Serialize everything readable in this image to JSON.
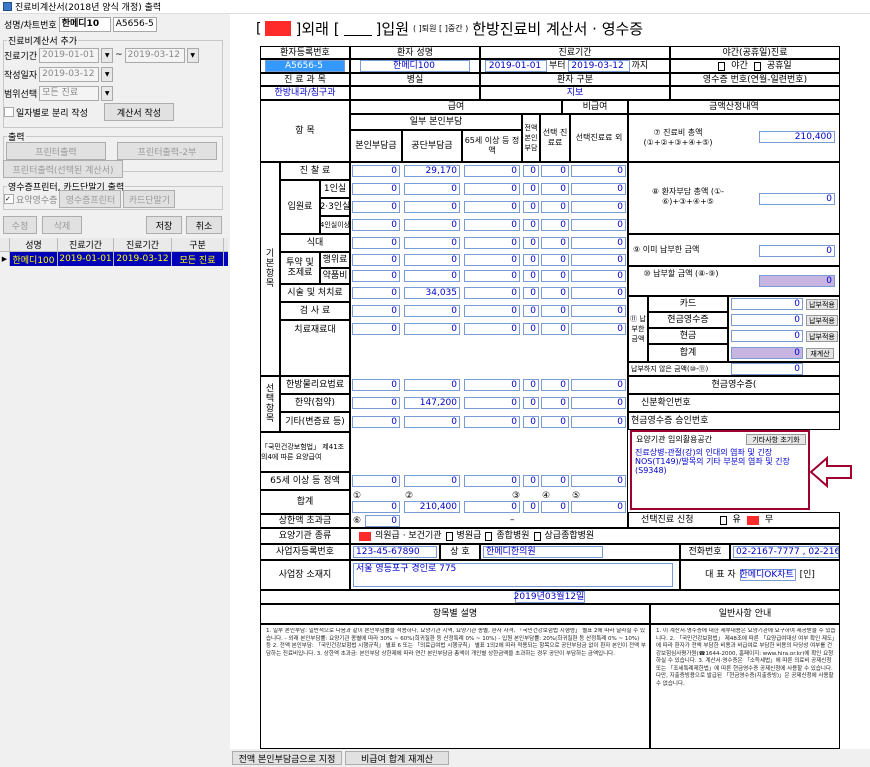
{
  "window": {
    "title": "진료비계산서(2018년 양식 개정) 출력"
  },
  "left": {
    "patient_label": "성명/차트번호",
    "patient_name": "한메디10",
    "chart_no": "A5656-5",
    "group_add_title": "진료비계산서 추가",
    "period_label": "진료기간",
    "period_from": "2019-01-01",
    "period_sep": "~",
    "period_to": "2019-03-12",
    "written_label": "작성일자",
    "written_date": "2019-03-12",
    "range_label": "범위선택",
    "range_value": "모든 진료",
    "split_check_label": "일자별로 분리 작성",
    "make_button": "계산서 작성",
    "group_print_title": "출력",
    "print_button": "프린터출력",
    "print2_button": "프린터출력-2부",
    "print_selected_button": "프린터출력(선택된 계산서)",
    "group_receipt_title": "영수증프린터, 카드단말기 출력",
    "receipt_check_label": "요약영수증",
    "receipt_printer_button": "영수증프린터",
    "card_button": "카드단말기",
    "edit_button": "수정",
    "delete_button": "삭제",
    "save_button": "저장",
    "cancel_button": "취소",
    "grid_headers": [
      "성명",
      "진료기간",
      "진료기간",
      "구분"
    ],
    "grid_rows": [
      {
        "name": "한메디100",
        "from": "2019-01-01",
        "to": "2019-03-12",
        "type": "모든 진료"
      }
    ]
  },
  "doc": {
    "title_outpatient": "]외래 [",
    "title_inpatient": "]입원",
    "title_small": "( ]퇴원 [ ]중간 )",
    "title_main": "한방진료비 계산서 · 영수증",
    "h_reg_no": "환자등록번호",
    "h_patient": "환자 성명",
    "h_period": "진료기간",
    "h_night": "야간(공휴일)진료",
    "reg_no": "A5656-5",
    "patient": "한메디100",
    "period_from": "2019-01-01",
    "period_from_suffix": "부터",
    "period_to": "2019-03-12",
    "period_to_suffix": "까지",
    "night": "야간",
    "holiday": "공휴일",
    "h_dept": "진 료 과 목",
    "h_ward": "병실",
    "h_ptype": "환자 구분",
    "h_receipt_no": "영수증 번호(연월-일련번호)",
    "dept": "한방내과/침구과",
    "ptype": "지보",
    "h_item": "항 목",
    "h_payment": "급여",
    "h_nonpay": "비급여",
    "h_amount": "금액산정내역",
    "h_partial": "일부 본인부담",
    "h_full": "전액 본인 부담",
    "h_choice": "선택 진료료",
    "h_other": "선택진료료 외",
    "h_self": "본인부담금",
    "h_insurer": "공단부담금",
    "h_65": "65세 이상 등 정액",
    "g_basic": "기본항목",
    "r_exam": "진 찰 료",
    "r_ward": "입원료",
    "r_1": "1인실",
    "r_23": "2·3인실",
    "r_4": "4인실이상",
    "r_meal": "식대",
    "r_herb": "투약 및 조제료",
    "r_herb1": "행위료",
    "r_herb2": "약품비",
    "r_acup": "시술 및 처치료",
    "r_test": "검 사 료",
    "r_mat": "치료재료대",
    "g_select": "선택항목",
    "r_phys": "한방물리요법료",
    "r_decoc": "한약(첩약)",
    "r_etc": "기타(변증료 등)",
    "note_law": "「국민건강보험법」 제41조의4에 따른 요양급여",
    "r_65": "65세 이상 등 정액",
    "r_sum": "합계",
    "r_upper": "상한액 초과금",
    "v_exam_ins": "29,170",
    "v_acup_ins": "34,035",
    "v_decoc_ins": "147,200",
    "v_sum_ins": "210,400",
    "zero": "0",
    "dash": "–",
    "c1": "①",
    "c2": "②",
    "c3": "③",
    "c4": "④",
    "c5": "⑤",
    "c6": "⑥",
    "a_total_label": "⑦ 진료비 총액 (①+②+③+④+⑤)",
    "a_total": "210,400",
    "a_patient_label": "⑧ 환자부담 총액 (①-⑥)+③+④+⑤",
    "a_paid_label": "⑨ 이미 납부한 금액",
    "a_due_label": "⑩ 납부할 금액 (⑧-⑨)",
    "a_pay_label": "⑪ 납부한 금액",
    "a_card": "카드",
    "a_cashrec": "현금영수증",
    "a_cash": "현금",
    "a_total2": "합계",
    "a_unpaid_label": "납부하지 않은 금액(⑩-⑪)",
    "a_cashrec2": "현금영수증(",
    "a_idcheck": "신분확인번호",
    "a_approval": "현금영수증 승인번호",
    "btn_pay": "납부적용",
    "btn_recalc": "재계산",
    "memo_label": "요양기관 임의활용공간",
    "memo_reset": "기타사항 초기화",
    "memo_text": "진료상병-관절(강)의 인대의 염좌 및 긴장 NOS(T149)/발목의 기타 부분의 염좌 및 긴장 (S9348)",
    "select_doctor": "선택진료 신청",
    "yes": "유",
    "no": "무",
    "inst_type_label": "요양기관 종류",
    "inst_1": "의원급 · 보건기관",
    "inst_2": "병원급",
    "inst_3": "종합병원",
    "inst_4": "상급종합병원",
    "biz_label": "사업자등록번호",
    "biz_no": "123-45-67890",
    "name_label": "상 호",
    "name": "한메디한의원",
    "tel_label": "전화번호",
    "tel": "02-2167-7777 , 02-2168-",
    "addr_label": "사업장 소재지",
    "addr": "서울 영등포구 경인로 775",
    "rep_label": "대 표 자",
    "rep": "한메디OK차트",
    "seal": "[인]",
    "issue_date": "2019년03월12일",
    "notes_title": "항목별 설명",
    "guide_title": "일반사항 안내",
    "notes_text": "1. 일부 본인부담: 일반적으로 다음과 같이 본인부담률을 적용하나, 요양기관 지역, 요양기관 종별, 환자 자격, 「국민건강보험법 시행령」 별표 2에 따라 달라질 수 있습니다. - 외래 본인부담률: 요양기관 종별에 따라 30% ~ 60%(희귀질환 등 산정특례 0% ~ 10%) - 입원 본인부담률: 20%(희귀질환 등 산정특례 0% ~ 10%) 등 2. 전액 본인부담: 「국민건강보험법 시행규칙」 별표 6 또는 「의료급여법 시행규칙」 별표 1의2에 따라 적용되는 항목으로 공단부담금 없이 환자 본인이 전액 부담하는 진료비입니다. 3. 상한액 초과금: 본인부담 상한제에 따라 연간 본인부담금 총액이 개인별 상한금액을 초과하는 경우 공단이 부담하는 금액입니다.",
    "guide_text": "1. 이 계산서·영수증에 대한 세부내용은 요양기관에 요구하여 제공받을 수 있습니다. 2. 「국민건강보험법」 제48조에 따른 「요양급여대상 여부 확인 제도」에 따라 환자가 전액 부담한 비용과 비급여로 부담한 비용의 타당성 여부를 건강보험심사평가원(☎1644-2000, 홈페이지: www.hira.or.kr)에 확인 요청하실 수 있습니다. 3. 계산서·영수증은 「소득세법」에 따른 의료비 공제신청 또는 「조세특례제한법」에 따른 현금영수증 공제신청에 사용할 수 있습니다. 다만, 지출증빙용으로 발급된 「현금영수증(지출증빙)」은 공제신청에 사용할 수 없습니다."
  },
  "bottom": {
    "btn_all_self": "전액 본인부담금으로 지정",
    "btn_recalc_sum": "비급여 합계 재계산"
  },
  "colors": {
    "accent": "#3399ff",
    "highlight": "#ff2a2a",
    "selected_row": "#0000b8"
  }
}
